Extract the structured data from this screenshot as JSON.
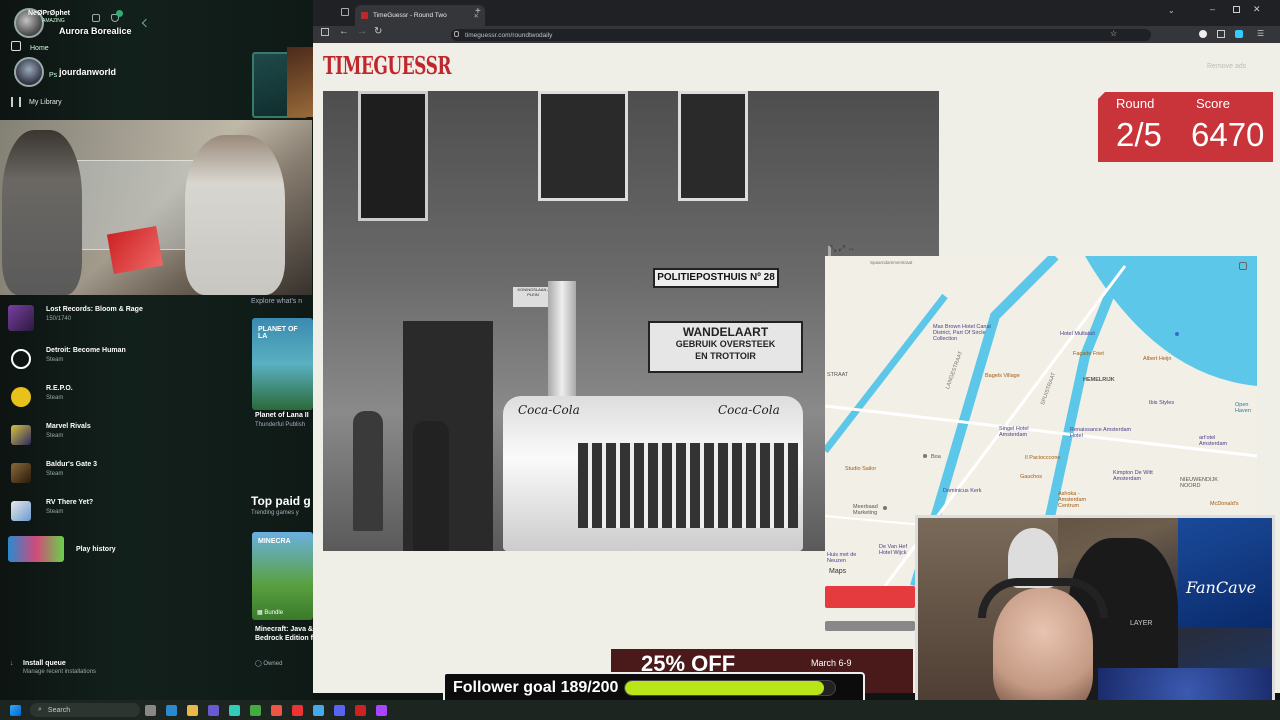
{
  "launcher": {
    "user1": "NeØPrØphet",
    "user1_sub": "AMAZING",
    "user2": "Aurora Borealice",
    "user3": "jourdanworld",
    "home": "Home",
    "people_prefix": "Ps",
    "library": "My Library",
    "explore": "Explore what's n",
    "games": [
      {
        "title": "Lost Records: Bloom & Rage",
        "sub": "150/1740",
        "color": "#7a3fa0"
      },
      {
        "title": "Detroit: Become Human",
        "sub": "Steam",
        "color": "#ffffff"
      },
      {
        "title": "R.E.P.O.",
        "sub": "Steam",
        "color": "#e8c21a"
      },
      {
        "title": "Marvel Rivals",
        "sub": "Steam",
        "color": "#d9c041"
      },
      {
        "title": "Baldur's Gate 3",
        "sub": "Steam",
        "color": "#6a4a2a"
      },
      {
        "title": "RV There Yet?",
        "sub": "Steam",
        "color": "#6a9bd0"
      },
      {
        "title": "Play history",
        "sub": "",
        "color": "#2a8ad0"
      }
    ],
    "store": {
      "planet_title": "Planet of Lana II",
      "planet_sub": "Thunderful Publish",
      "planet_art": "PLANET OF LA",
      "top_paid": "Top paid g",
      "trending": "Trending games y",
      "minecraft_art": "MINECRA",
      "bundle": "Bundle",
      "minecraft_title": "Minecraft: Java &",
      "minecraft_sub": "Bedrock Edition f",
      "owned": "Owned"
    },
    "install_queue": "Install queue",
    "install_sub": "Manage recent installations"
  },
  "browser": {
    "tab_title": "TimeGuessr - Round Two",
    "url": "timeguessr.com/roundtwodaily"
  },
  "page": {
    "logo": "TIMEGUESSR",
    "remove_ads": "Remove ads",
    "round_label": "Round",
    "score_label": "Score",
    "round_value": "2/5",
    "score_value": "6470",
    "photo_sign1": "POLITIEPOSTHUIS Nº 28",
    "photo_sign2a": "WANDELAART",
    "photo_sign2b": "GEBRUIK OVERSTEEK",
    "photo_sign2c": "EN TROTTOIR",
    "photo_ad": "Coca-Cola",
    "photo_street_left": "KONINGSLAAN / PLEIN",
    "ad_banner_main": "25% OFF",
    "ad_banner_date": "March 6-9"
  },
  "map": {
    "attribution": "Maps",
    "places": [
      {
        "label": "Max Brown Hotel Canal District, Part Of Sircle Collection",
        "kind": "purple"
      },
      {
        "label": "Hotel Multatuli",
        "kind": "purple"
      },
      {
        "label": "Façade Friet",
        "kind": "orange"
      },
      {
        "label": "Albert Heijn",
        "kind": "orange"
      },
      {
        "label": "Bagels Village",
        "kind": "orange"
      },
      {
        "label": "HEMELRIJK",
        "kind": "district"
      },
      {
        "label": "Ibis Styles",
        "kind": "purple"
      },
      {
        "label": "Singel Hotel Amsterdam",
        "kind": "purple"
      },
      {
        "label": "Renaissance Amsterdam Hotel",
        "kind": "purple"
      },
      {
        "label": "art'otel Amsterdam",
        "kind": "purple"
      },
      {
        "label": "Il Paciocccone",
        "kind": "orange"
      },
      {
        "label": "Studio Sailor",
        "kind": "orange"
      },
      {
        "label": "Boa",
        "kind": "gray"
      },
      {
        "label": "Kimpton De Witt Amsterdam",
        "kind": "purple"
      },
      {
        "label": "Gauchos",
        "kind": "orange"
      },
      {
        "label": "NIEUWENDIJK NOORD",
        "kind": "district"
      },
      {
        "label": "Dominicus Kerk",
        "kind": "purple"
      },
      {
        "label": "Ashoka - Amsterdam Centrum",
        "kind": "orange"
      },
      {
        "label": "Meerbaad Marketing",
        "kind": "gray"
      },
      {
        "label": "Huis met de Neuzen",
        "kind": "purple"
      },
      {
        "label": "De Van Hef Hotel Wijck",
        "kind": "purple"
      },
      {
        "label": "McDonald's",
        "kind": "orange"
      },
      {
        "label": "STRAAT",
        "kind": "district"
      },
      {
        "label": "LANGESTRAAT",
        "kind": "street"
      },
      {
        "label": "SPUISTRAAT",
        "kind": "street"
      },
      {
        "label": "Spaarndammerstraat",
        "kind": "street"
      },
      {
        "label": "Open Haven",
        "kind": "water"
      }
    ]
  },
  "overlay": {
    "goal_label": "Follower goal 189/200",
    "goal_progress": 0.945,
    "chair_brand": "LAYER",
    "poster_text": "FanCave"
  },
  "taskbar": {
    "search": "Search"
  },
  "colors": {
    "brand_red": "#c0272d",
    "score_bg": "#c8343a",
    "goal_fill": "#b7e517",
    "water": "#5cc7e8"
  }
}
